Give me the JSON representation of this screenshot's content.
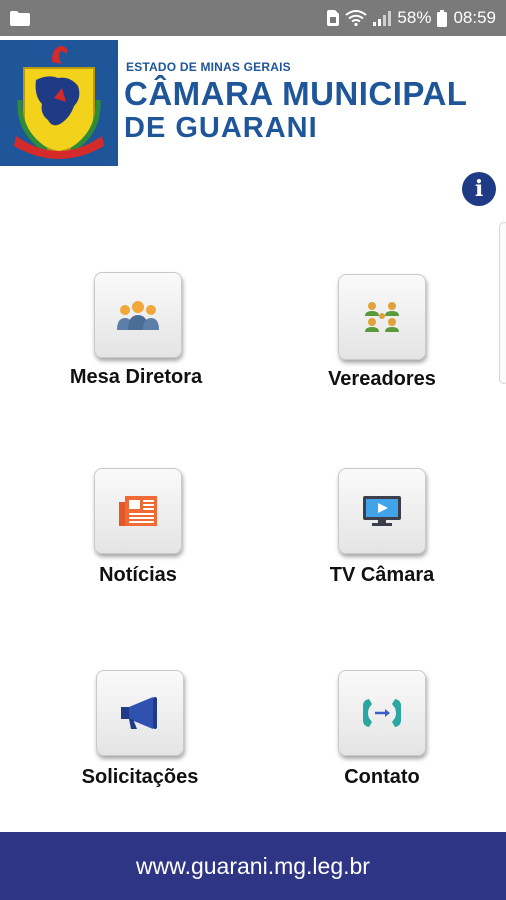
{
  "status_bar": {
    "battery_percent": "58%",
    "time": "08:59",
    "icons": [
      "folder-icon",
      "sim-icon",
      "wifi-icon",
      "signal-icon",
      "battery-icon"
    ]
  },
  "header": {
    "state": "ESTADO DE MINAS GERAIS",
    "title_line1": "CÂMARA MUNICIPAL",
    "title_line2": "DE GUARANI",
    "brand_color": "#1f5599"
  },
  "info_button": {
    "icon": "info-icon"
  },
  "menu": {
    "items": [
      {
        "label": "Mesa Diretora",
        "icon": "people-group-icon"
      },
      {
        "label": "Vereadores",
        "icon": "council-members-icon"
      },
      {
        "label": "Notícias",
        "icon": "newspaper-icon"
      },
      {
        "label": "TV Câmara",
        "icon": "tv-icon"
      },
      {
        "label": "Solicitações",
        "icon": "megaphone-icon"
      },
      {
        "label": "Contato",
        "icon": "phone-contact-icon"
      }
    ]
  },
  "footer": {
    "url": "www.guarani.mg.leg.br",
    "color": "#2f3585"
  }
}
